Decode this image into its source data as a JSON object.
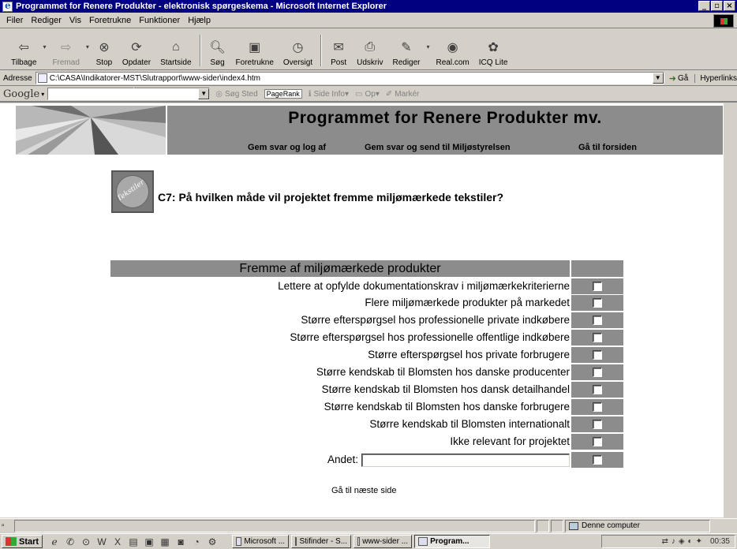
{
  "window": {
    "title": "Programmet for Renere Produkter - elektronisk spørgeskema - Microsoft Internet Explorer"
  },
  "menu": [
    "Filer",
    "Rediger",
    "Vis",
    "Foretrukne",
    "Funktioner",
    "Hjælp"
  ],
  "toolbar": {
    "back": "Tilbage",
    "forward": "Fremad",
    "stop": "Stop",
    "refresh": "Opdater",
    "home": "Startside",
    "search": "Søg",
    "favorites": "Foretrukne",
    "history": "Oversigt",
    "mail": "Post",
    "print": "Udskriv",
    "edit": "Rediger",
    "real": "Real.com",
    "icq": "ICQ Lite"
  },
  "address": {
    "label": "Adresse",
    "value": "C:\\CASA\\Indikatorer-MST\\Slutrapport\\www-sider\\index4.htm",
    "go": "Gå",
    "links": "Hyperlinks"
  },
  "googlebar": {
    "logo": "Google",
    "search_site": "Søg Sted",
    "pagerank": "PageRank",
    "page_info": "Side Info",
    "up": "Op",
    "highlight": "Markér"
  },
  "banner": {
    "title": "Programmet for Renere Produkter mv.",
    "nav": [
      "Gem svar og log af",
      "Gem svar og send til Miljøstyrelsen",
      "Gå til forsiden"
    ]
  },
  "question": {
    "icon_text": "Tekstiler",
    "text": "C7: På hvilken måde vil projektet fremme miljømærkede tekstiler?"
  },
  "table": {
    "header": "Fremme af miljømærkede produkter",
    "rows": [
      "Lettere at opfylde dokumentationskrav i miljømærkekriterierne",
      "Flere miljømærkede produkter på markedet",
      "Større efterspørgsel hos professionelle private indkøbere",
      "Større efterspørgsel hos professionelle offentlige indkøbere",
      "Større efterspørgsel hos private forbrugere",
      "Større kendskab til Blomsten hos danske producenter",
      "Større kendskab til Blomsten hos dansk detailhandel",
      "Større kendskab til Blomsten hos danske forbrugere",
      "Større kendskab til Blomsten internationalt",
      "Ikke relevant for projektet"
    ],
    "other_label": "Andet:",
    "other_value": ""
  },
  "next_link": "Gå til næste side",
  "statusbar": {
    "zone": "Denne computer"
  },
  "taskbar": {
    "start": "Start",
    "tasks": [
      "Microsoft ...",
      "Stifinder - S...",
      "www-sider ...",
      "Program..."
    ],
    "clock": "00:35"
  }
}
